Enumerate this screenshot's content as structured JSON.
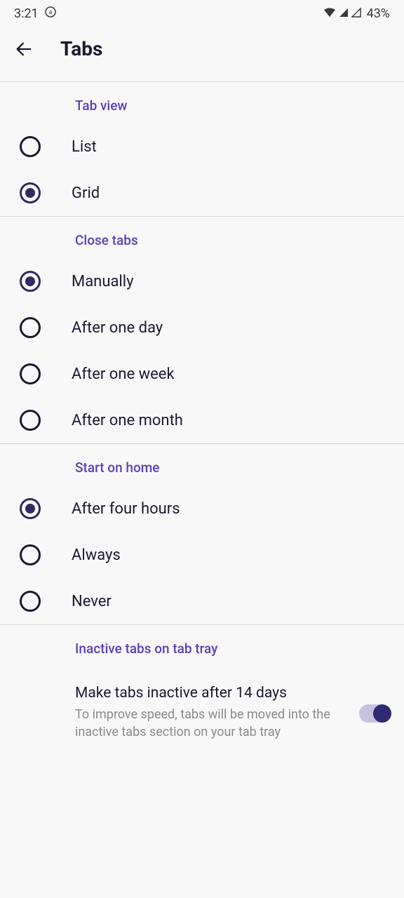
{
  "status": {
    "time": "3:21",
    "battery": "43%"
  },
  "header": {
    "title": "Tabs"
  },
  "sections": {
    "tab_view": {
      "header": "Tab view",
      "options": [
        "List",
        "Grid"
      ]
    },
    "close_tabs": {
      "header": "Close tabs",
      "options": [
        "Manually",
        "After one day",
        "After one week",
        "After one month"
      ]
    },
    "start_home": {
      "header": "Start on home",
      "options": [
        "After four hours",
        "Always",
        "Never"
      ]
    },
    "inactive": {
      "header": "Inactive tabs on tab tray",
      "toggle_title": "Make tabs inactive after 14 days",
      "toggle_desc": "To improve speed, tabs will be moved into the inactive tabs section on your tab tray"
    }
  }
}
